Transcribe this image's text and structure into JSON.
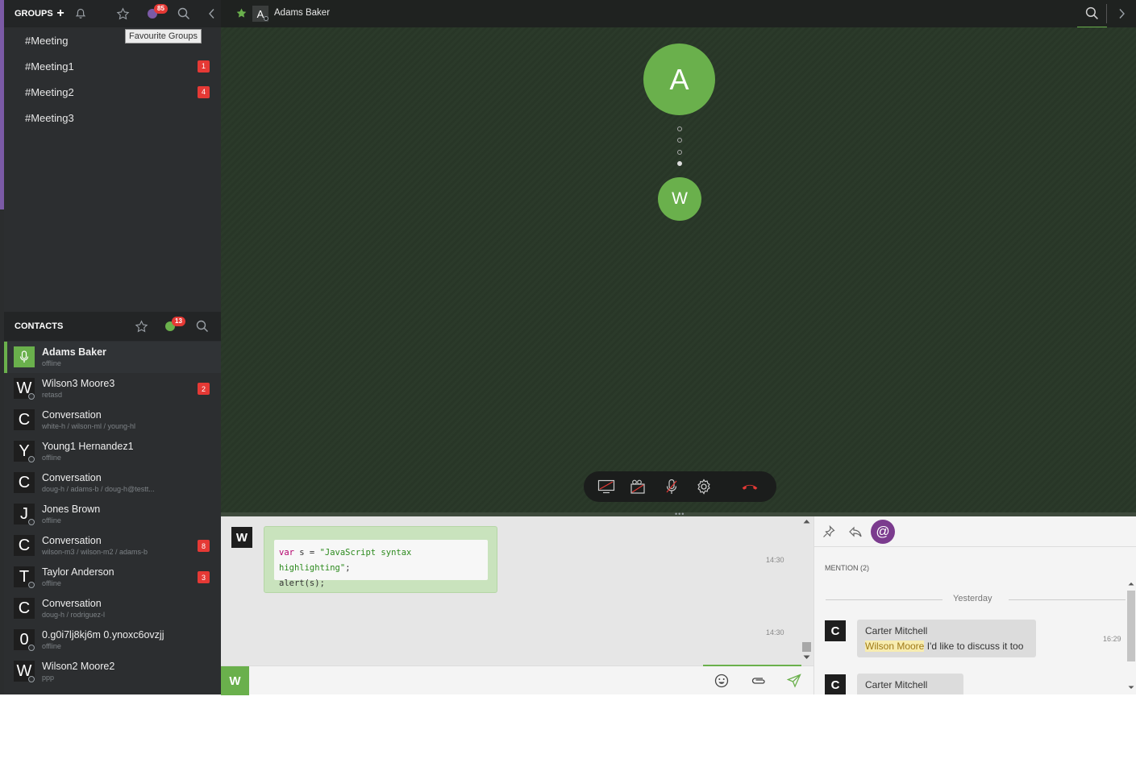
{
  "groups": {
    "header": "GROUPS",
    "unread_badge": "85",
    "tooltip": "Favourite Groups",
    "items": [
      {
        "label": "#Meeting",
        "badge": ""
      },
      {
        "label": "#Meeting1",
        "badge": "1"
      },
      {
        "label": "#Meeting2",
        "badge": "4"
      },
      {
        "label": "#Meeting3",
        "badge": ""
      }
    ]
  },
  "contacts": {
    "header": "CONTACTS",
    "unread_badge": "13",
    "items": [
      {
        "initial": "",
        "name": "Adams Baker",
        "sub": "offline",
        "badge": ""
      },
      {
        "initial": "W",
        "name": "Wilson3 Moore3",
        "sub": "retasd",
        "badge": "2"
      },
      {
        "initial": "C",
        "name": "Conversation",
        "sub": "white-h / wilson-ml / young-hl",
        "badge": ""
      },
      {
        "initial": "Y",
        "name": "Young1 Hernandez1",
        "sub": "offline",
        "badge": ""
      },
      {
        "initial": "C",
        "name": "Conversation",
        "sub": "doug-h / adams-b / doug-h@testt...",
        "badge": ""
      },
      {
        "initial": "J",
        "name": "Jones Brown",
        "sub": "offline",
        "badge": ""
      },
      {
        "initial": "C",
        "name": "Conversation",
        "sub": "wilson-m3 / wilson-m2 / adams-b",
        "badge": "8"
      },
      {
        "initial": "T",
        "name": "Taylor Anderson",
        "sub": "offline",
        "badge": "3"
      },
      {
        "initial": "C",
        "name": "Conversation",
        "sub": "doug-h / rodriguez-l",
        "badge": ""
      },
      {
        "initial": "0",
        "name": "0.g0i7lj8kj6m 0.ynoxc6ovzjj",
        "sub": "offline",
        "badge": ""
      },
      {
        "initial": "W",
        "name": "Wilson2 Moore2",
        "sub": "ppp",
        "badge": ""
      }
    ]
  },
  "topbar": {
    "avatar_initial": "A",
    "title": "Adams Baker"
  },
  "call": {
    "caller_initial": "A",
    "callee_initial": "W"
  },
  "chat": {
    "sender_initial": "W",
    "code_line1_kw": "var",
    "code_line1_mid": " s = ",
    "code_line1_str": "\"JavaScript syntax highlighting\"",
    "code_line1_end": ";",
    "code_line2": "alert(s);",
    "time1": "14:30",
    "time2": "14:30",
    "compose_initial": "W"
  },
  "mentions": {
    "at_symbol": "@",
    "label": "MENTION (2)",
    "day": "Yesterday",
    "items": [
      {
        "initial": "C",
        "name": "Carter Mitchell",
        "mention": "Wilson Moore",
        "text": " I'd like to discuss it too",
        "time": "16:29"
      },
      {
        "initial": "C",
        "name": "Carter Mitchell",
        "mention": "",
        "text": "",
        "time": ""
      }
    ]
  },
  "colors": {
    "accent_green": "#6ab04c",
    "badge_red": "#e53935",
    "mention_purple": "#7b3b8e"
  }
}
